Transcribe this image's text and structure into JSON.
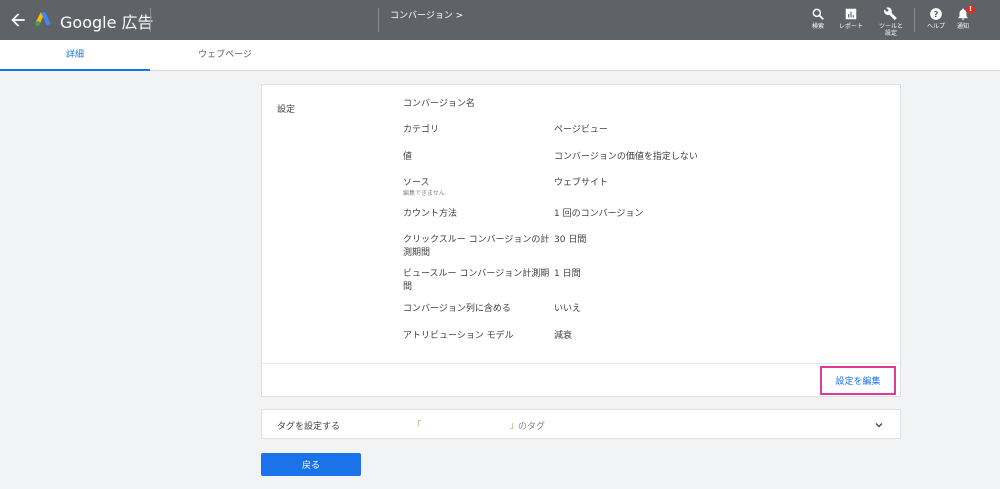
{
  "header": {
    "brand": "Google 広告",
    "breadcrumb": "コンバージョン >",
    "tools": [
      {
        "icon": "search-icon",
        "label": "検索"
      },
      {
        "icon": "report-icon",
        "label": "レポート"
      },
      {
        "icon": "wrench-icon",
        "label": "ツールと\n設定"
      },
      {
        "icon": "help-icon",
        "label": "ヘルプ"
      },
      {
        "icon": "bell-icon",
        "label": "通知"
      }
    ],
    "notification_badge": "!"
  },
  "tabs": [
    "詳細",
    "ウェブページ"
  ],
  "settings": {
    "section_label": "設定",
    "conversion_name_label": "コンバージョン名",
    "rows": [
      {
        "label": "カテゴリ",
        "value": "ページビュー"
      },
      {
        "label": "値",
        "value": "コンバージョンの価値を指定しない"
      },
      {
        "label": "ソース",
        "sub": "編集できません",
        "value": "ウェブサイト"
      },
      {
        "label": "カウント方法",
        "value": "1 回のコンバージョン"
      },
      {
        "label": "クリックスルー コンバージョンの計測期間",
        "value": "30 日間"
      },
      {
        "label": "ビュースルー コンバージョン計測期間",
        "value": "1 日間"
      },
      {
        "label": "コンバージョン列に含める",
        "value": "いいえ"
      },
      {
        "label": "アトリビューション モデル",
        "value": "減衰"
      }
    ],
    "edit_button": "設定を編集"
  },
  "tag": {
    "title": "タグを設定する",
    "open_quote": "「",
    "close_quote": "」",
    "suffix": "のタグ"
  },
  "back_button": "戻る",
  "colors": {
    "topbar": "#5f6368",
    "accent": "#1a73e8",
    "highlight": "#e0399a"
  }
}
